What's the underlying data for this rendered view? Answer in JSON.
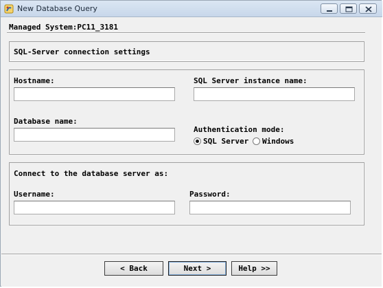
{
  "window": {
    "title": "New Database Query",
    "icon": "app-icon",
    "controls": [
      "minimize-icon",
      "restore-icon",
      "close-icon"
    ]
  },
  "header": {
    "managed_system": "Managed System:PC11_3181"
  },
  "section_title": "SQL-Server connection settings",
  "connection": {
    "hostname_label": "Hostname:",
    "hostname_value": "",
    "instance_label": "SQL Server instance name:",
    "instance_value": "",
    "database_label": "Database name:",
    "database_value": "",
    "auth_label": "Authentication mode:",
    "auth_options": [
      "SQL Server",
      "Windows"
    ],
    "auth_selected": "SQL Server"
  },
  "credentials": {
    "title": "Connect to the database server as:",
    "username_label": "Username:",
    "username_value": "",
    "password_label": "Password:",
    "password_value": ""
  },
  "footer": {
    "back_label": "< Back",
    "next_label": "Next >",
    "help_label": "Help >>"
  }
}
